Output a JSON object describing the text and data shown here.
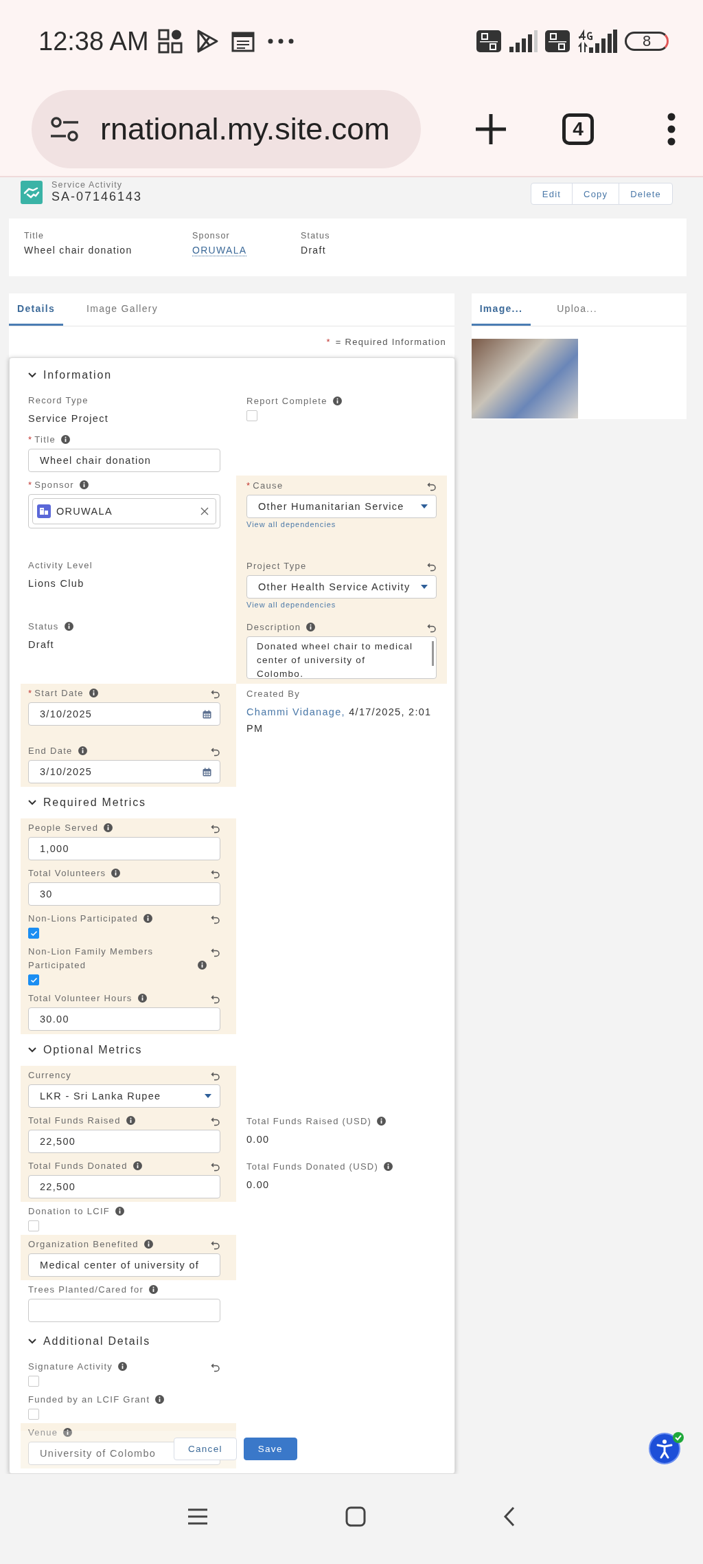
{
  "status_bar": {
    "time": "12:38 AM",
    "battery": "8"
  },
  "browser": {
    "url": "rnational.my.site.com",
    "tab_count": "4"
  },
  "record": {
    "object": "Service Activity",
    "number": "SA-07146143",
    "actions": [
      "Edit",
      "Copy",
      "Delete"
    ]
  },
  "highlights": [
    {
      "label": "Title",
      "value": "Wheel chair donation",
      "kind": "text"
    },
    {
      "label": "Sponsor",
      "value": "ORUWALA",
      "kind": "link"
    },
    {
      "label": "Status",
      "value": "Draft",
      "kind": "text"
    }
  ],
  "tabs": [
    {
      "label": "Details",
      "selected": true
    },
    {
      "label": "Image Gallery",
      "selected": false
    }
  ],
  "required_note": {
    "mark": "*",
    "text": "= Required Information"
  },
  "side_tabs": [
    {
      "label": "Image...",
      "selected": true
    },
    {
      "label": "Uploa...",
      "selected": false
    }
  ],
  "sections": [
    {
      "title": "Information",
      "expanded": true,
      "rows": [
        {
          "left": {
            "kind": "output",
            "label": "Record Type",
            "value": "Service Project"
          },
          "right": {
            "kind": "checkbox",
            "label": "Report Complete",
            "checked": false,
            "info": true
          }
        },
        {
          "left": {
            "kind": "input",
            "mark": "*",
            "label": "Title",
            "value": "Wheel chair donation",
            "info": true
          }
        },
        {
          "left": {
            "kind": "lookup",
            "mark": "*",
            "label": "Sponsor",
            "value": "ORUWALA",
            "info": true
          },
          "right": {
            "kind": "select",
            "mark": "*",
            "label": "Cause",
            "value": "Other Humanitarian Service",
            "link": "View all dependencies",
            "undo": true,
            "highlight": true
          }
        },
        {
          "left": {
            "kind": "output",
            "label": "Activity Level",
            "value": "Lions Club"
          },
          "right": {
            "kind": "select",
            "label": "Project Type",
            "value": "Other Health Service Activity",
            "link": "View all dependencies",
            "undo": true,
            "highlight": true
          }
        },
        {
          "left": {
            "kind": "output",
            "label": "Status",
            "value": "Draft",
            "info": true
          },
          "right": {
            "kind": "textarea",
            "label": "Description",
            "value": "Donated wheel chair to medical center of university of Colombo.",
            "info": true,
            "undo": true,
            "highlight": true
          }
        },
        {
          "left": {
            "kind": "date",
            "mark": "*",
            "label": "Start Date",
            "value": "3/10/2025",
            "info": true,
            "undo": true,
            "highlight": true
          },
          "right": {
            "kind": "output",
            "label": "Created By",
            "link": "Chammi Vidanage,",
            "value": "4/17/2025, 2:01 PM"
          }
        },
        {
          "left": {
            "kind": "date",
            "label": "End Date",
            "value": "3/10/2025",
            "info": true,
            "undo": true,
            "highlight": true
          }
        }
      ]
    },
    {
      "title": "Required Metrics",
      "expanded": true,
      "rows": [
        {
          "left": {
            "kind": "input",
            "label": "People Served",
            "value": "1,000",
            "info": true,
            "undo": true,
            "highlight": true
          }
        },
        {
          "left": {
            "kind": "input",
            "label": "Total Volunteers",
            "value": "30",
            "info": true,
            "undo": true,
            "highlight": true
          }
        },
        {
          "left": {
            "kind": "checkbox",
            "label": "Non-Lions Participated",
            "checked": true,
            "info": true,
            "undo": true,
            "highlight": true
          }
        },
        {
          "left": {
            "kind": "checkbox",
            "label": "Non-Lion Family Members Participated",
            "checked": true,
            "info": true,
            "undo": true,
            "highlight": true
          }
        },
        {
          "left": {
            "kind": "input",
            "label": "Total Volunteer Hours",
            "value": "30.00",
            "info": true,
            "undo": true,
            "highlight": true
          }
        }
      ]
    },
    {
      "title": "Optional Metrics",
      "expanded": true,
      "rows": [
        {
          "left": {
            "kind": "select",
            "label": "Currency",
            "value": "LKR - Sri Lanka Rupee",
            "undo": true,
            "highlight": true
          }
        },
        {
          "left": {
            "kind": "input",
            "label": "Total Funds Raised",
            "value": "22,500",
            "info": true,
            "undo": true,
            "highlight": true
          },
          "right": {
            "kind": "output",
            "label": "Total Funds Raised (USD)",
            "value": "0.00",
            "info": true
          }
        },
        {
          "left": {
            "kind": "input",
            "label": "Total Funds Donated",
            "value": "22,500",
            "info": true,
            "undo": true,
            "highlight": true
          },
          "right": {
            "kind": "output",
            "label": "Total Funds Donated (USD)",
            "value": "0.00",
            "info": true
          }
        },
        {
          "left": {
            "kind": "checkbox",
            "label": "Donation to LCIF",
            "checked": false,
            "info": true
          }
        },
        {
          "left": {
            "kind": "input",
            "label": "Organization Benefited",
            "value": "Medical center of university of",
            "info": true,
            "undo": true,
            "highlight": true
          }
        },
        {
          "left": {
            "kind": "input",
            "label": "Trees Planted/Cared for",
            "info": true
          }
        }
      ]
    },
    {
      "title": "Additional Details",
      "expanded": true,
      "rows": [
        {
          "left": {
            "kind": "checkbox",
            "label": "Signature Activity",
            "checked": false,
            "info": true,
            "undo": true
          }
        },
        {
          "left": {
            "kind": "checkbox",
            "label": "Funded by an LCIF Grant",
            "checked": false,
            "info": true
          }
        },
        {
          "left": {
            "kind": "input",
            "label": "Venue",
            "value": "University of Colombo",
            "info": true,
            "highlight": true
          }
        }
      ]
    }
  ],
  "footer": {
    "buttons": [
      {
        "label": "Cancel",
        "kind": "neutral"
      },
      {
        "label": "Save",
        "kind": "brand"
      }
    ]
  }
}
